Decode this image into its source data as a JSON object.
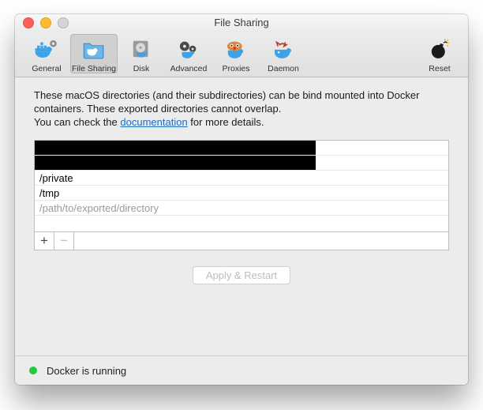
{
  "window": {
    "title": "File Sharing"
  },
  "toolbar": {
    "tabs": [
      {
        "id": "general",
        "label": "General"
      },
      {
        "id": "sharing",
        "label": "File Sharing"
      },
      {
        "id": "disk",
        "label": "Disk"
      },
      {
        "id": "advanced",
        "label": "Advanced"
      },
      {
        "id": "proxies",
        "label": "Proxies"
      },
      {
        "id": "daemon",
        "label": "Daemon"
      }
    ],
    "selected_tab": "sharing",
    "reset_label": "Reset"
  },
  "description": {
    "line1": "These macOS directories (and their subdirectories) can be bind mounted into Docker containers. These exported directories cannot overlap.",
    "line2_pre": "You can check the ",
    "line2_link": "documentation",
    "line2_post": " for more details."
  },
  "paths": {
    "rows": [
      {
        "redacted": true,
        "value": ""
      },
      {
        "redacted": true,
        "value": ""
      },
      {
        "redacted": false,
        "value": "/private"
      },
      {
        "redacted": false,
        "value": "/tmp"
      }
    ],
    "placeholder": "/path/to/exported/directory"
  },
  "controls": {
    "add_label": "+",
    "remove_label": "−",
    "apply_label": "Apply & Restart"
  },
  "status": {
    "text": "Docker is running",
    "color": "#29c740"
  }
}
